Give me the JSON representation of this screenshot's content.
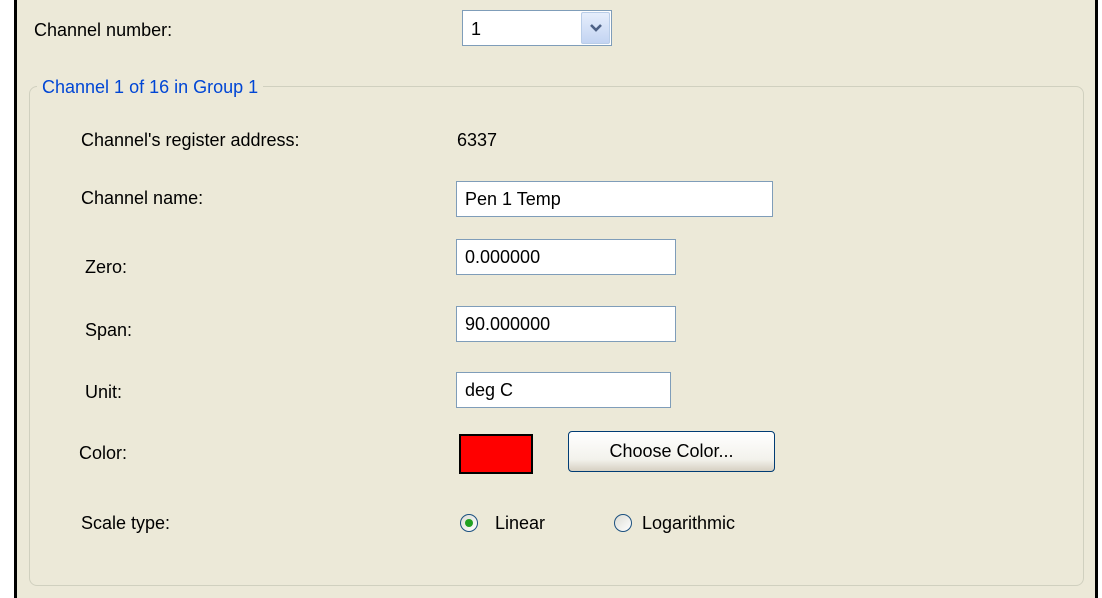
{
  "channel_number": {
    "label": "Channel number:",
    "selected": "1"
  },
  "group": {
    "title": "Channel 1 of 16 in Group 1",
    "register_label": "Channel's register address:",
    "register_value": "6337",
    "name_label": "Channel name:",
    "name_value": "Pen 1 Temp",
    "zero_label": "Zero:",
    "zero_value": "0.000000",
    "span_label": "Span:",
    "span_value": "90.000000",
    "unit_label": "Unit:",
    "unit_value": "deg C",
    "color_label": "Color:",
    "color_value": "#ff0000",
    "choose_color_label": "Choose Color...",
    "scale_label": "Scale type:",
    "scale_options": [
      {
        "label": "Linear",
        "selected": true
      },
      {
        "label": "Logarithmic",
        "selected": false
      }
    ]
  },
  "icons": {
    "combo_arrow": "chevron-down-icon",
    "radio": "radio-button-icon"
  }
}
